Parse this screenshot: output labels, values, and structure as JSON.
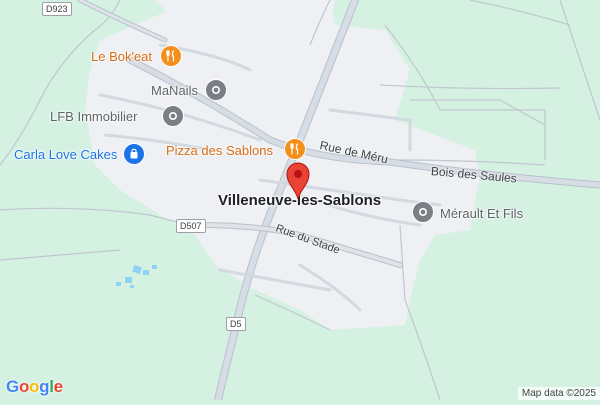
{
  "map": {
    "town_label": "Villeneuve-les-Sablons",
    "streets": [
      {
        "id": "rue-de-meru",
        "label": "Rue de Méru"
      },
      {
        "id": "bois-des-saules",
        "label": "Bois des Saules"
      },
      {
        "id": "rue-du-stade",
        "label": "Rue du Stade"
      }
    ],
    "road_shields": [
      "D923",
      "D507",
      "D5"
    ],
    "places": [
      {
        "id": "le-bokeat",
        "label": "Le Bok'eat",
        "category": "restaurant",
        "icon": "fork-knife-icon"
      },
      {
        "id": "manails",
        "label": "MaNails",
        "category": "service",
        "icon": "generic-place-icon"
      },
      {
        "id": "lfb-immobilier",
        "label": "LFB Immobilier",
        "category": "service",
        "icon": "generic-place-icon"
      },
      {
        "id": "carla-love-cakes",
        "label": "Carla Love Cakes",
        "category": "shop",
        "icon": "shopping-bag-icon"
      },
      {
        "id": "pizza-des-sablons",
        "label": "Pizza des Sablons",
        "category": "restaurant",
        "icon": "fork-knife-icon"
      },
      {
        "id": "merault-et-fils",
        "label": "Mérault Et Fils",
        "category": "service",
        "icon": "generic-place-icon"
      }
    ],
    "marker": {
      "type": "red-location-pin",
      "icon": "map-marker-icon"
    },
    "colors": {
      "background": "#d4f1e2",
      "town_area": "#eef0f3",
      "road": "#c4cbd4",
      "restaurant": "#f58f1c",
      "shop": "#1a73e8",
      "service": "#7b7f85",
      "marker": "#ea4335"
    }
  },
  "footer": {
    "logo": "Google",
    "attribution": "Map data ©2025"
  }
}
